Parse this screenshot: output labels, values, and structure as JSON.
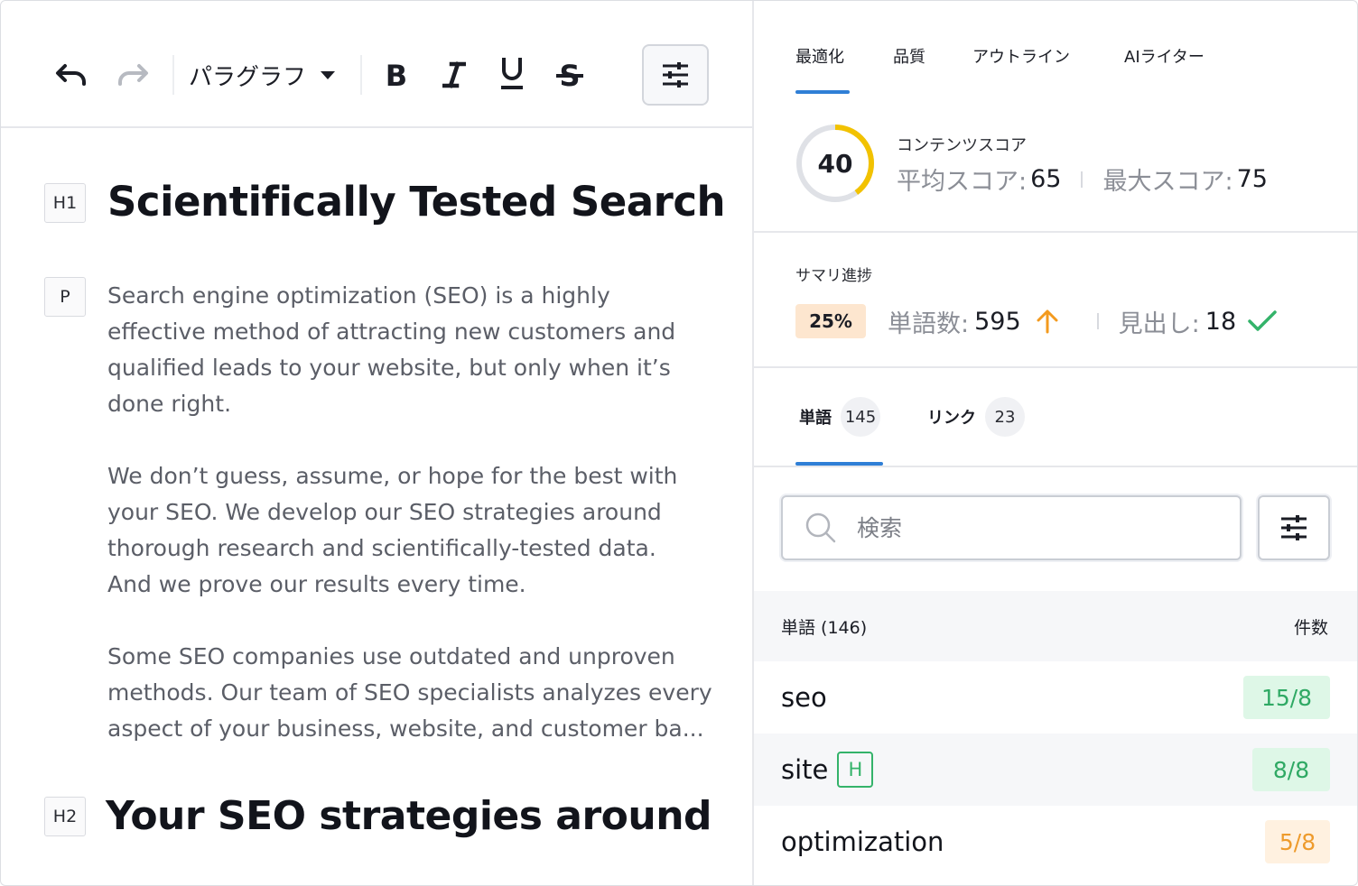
{
  "editor": {
    "toolbar": {
      "paragraph_select": "パラグラフ",
      "icons": [
        "undo-icon",
        "redo-icon",
        "bold-icon",
        "italic-icon",
        "underline-icon",
        "strikethrough-icon",
        "sliders-icon"
      ]
    },
    "blocks": [
      {
        "tag": "H1",
        "text": "Scientifically Tested Search"
      },
      {
        "tag": "P",
        "lines": [
          "Search engine optimization (SEO) is a highly",
          "effective method of attracting new customers and",
          "qualified leads to your website, but only when it’s",
          "done right.",
          "",
          "We don’t guess, assume, or hope for the best with",
          "your SEO. We develop our SEO strategies around",
          "thorough research and scientifically-tested data.",
          "And we prove our results every time.",
          "",
          "Some SEO companies use outdated and unproven",
          "methods. Our team of SEO specialists analyzes every",
          "aspect of your business, website, and customer ba..."
        ]
      },
      {
        "tag": "H2",
        "text": "Your SEO strategies around"
      }
    ]
  },
  "sidebar": {
    "tabs": [
      {
        "label": "最適化",
        "active": true
      },
      {
        "label": "品質",
        "active": false
      },
      {
        "label": "アウトライン",
        "active": false
      },
      {
        "label": "AIライター",
        "active": false
      }
    ],
    "score": {
      "value": "40",
      "fraction": 0.4,
      "label": "コンテンツスコア",
      "avg_label": "平均スコア:",
      "avg_value": "65",
      "max_label": "最大スコア:",
      "max_value": "75",
      "ring_color": "#f2c200"
    },
    "progress": {
      "label": "サマリ進捗",
      "percent": "25%",
      "words_label": "単語数:",
      "words_value": "595",
      "headings_label": "見出し:",
      "headings_value": "18"
    },
    "subtabs": [
      {
        "label": "単語",
        "count": "145",
        "active": true
      },
      {
        "label": "リンク",
        "count": "23",
        "active": false
      }
    ],
    "search": {
      "placeholder": "検索"
    },
    "list": {
      "header_left": "単語 (146)",
      "header_right": "件数",
      "rows": [
        {
          "word": "seo",
          "heading_tag": "",
          "count": "15/8",
          "status": "green"
        },
        {
          "word": "site",
          "heading_tag": "H",
          "count": "8/8",
          "status": "green"
        },
        {
          "word": "optimization",
          "heading_tag": "",
          "count": "5/8",
          "status": "orange"
        }
      ]
    },
    "colors": {
      "accent": "#2f7fd6",
      "good": "#34b36a",
      "warn": "#ee9b2c"
    }
  }
}
